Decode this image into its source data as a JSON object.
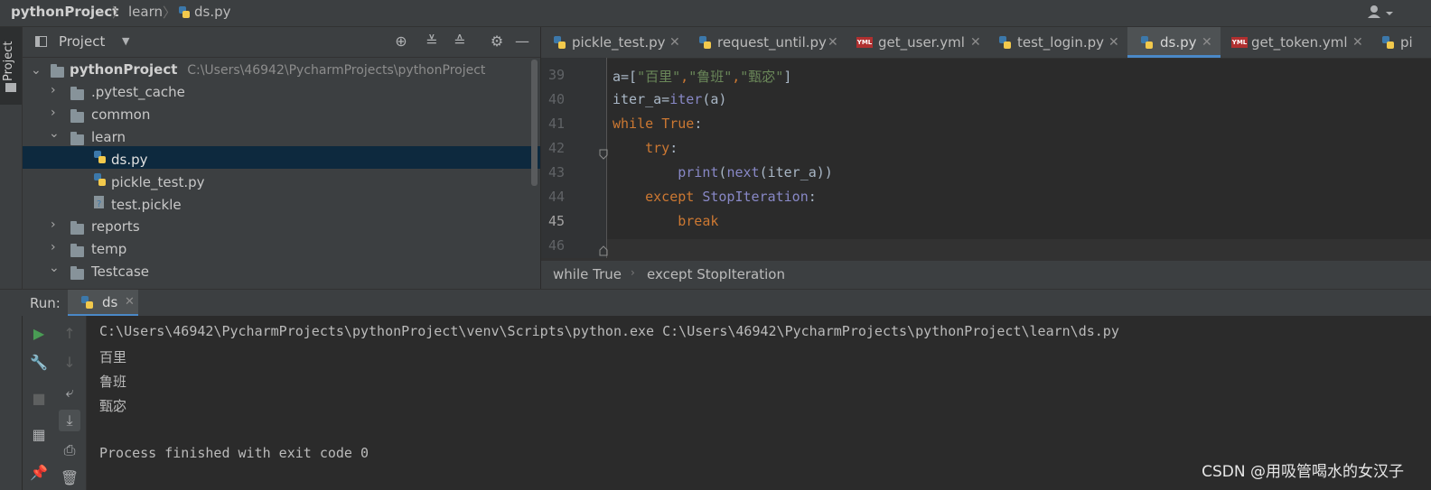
{
  "navbar": {
    "crumbs": [
      "pythonProject",
      "learn",
      "ds.py"
    ],
    "user_icon": "user-icon"
  },
  "left_stripe": {
    "project_label": "Project"
  },
  "project_panel": {
    "title": "Project",
    "tree": [
      {
        "label": "pythonProject",
        "path": "C:\\Users\\46942\\PycharmProjects\\pythonProject",
        "type": "folder",
        "expanded": true
      },
      {
        "label": ".pytest_cache",
        "type": "folder",
        "expanded": false
      },
      {
        "label": "common",
        "type": "folder",
        "expanded": false
      },
      {
        "label": "learn",
        "type": "folder",
        "expanded": true
      },
      {
        "label": "ds.py",
        "type": "python-file",
        "selected": true
      },
      {
        "label": "pickle_test.py",
        "type": "python-file"
      },
      {
        "label": "test.pickle",
        "type": "unknown-file"
      },
      {
        "label": "reports",
        "type": "folder",
        "expanded": false
      },
      {
        "label": "temp",
        "type": "folder",
        "expanded": false
      },
      {
        "label": "Testcase",
        "type": "folder",
        "expanded": true
      }
    ]
  },
  "editor": {
    "tabs": [
      {
        "label": "pickle_test.py",
        "type": "python"
      },
      {
        "label": "request_until.py",
        "type": "python"
      },
      {
        "label": "get_user.yml",
        "type": "yml"
      },
      {
        "label": "test_login.py",
        "type": "python"
      },
      {
        "label": "ds.py",
        "type": "python",
        "active": true
      },
      {
        "label": "get_token.yml",
        "type": "yml"
      },
      {
        "label": "pi",
        "type": "python"
      }
    ],
    "yml_badge": "YML",
    "line_numbers": [
      "39",
      "40",
      "41",
      "42",
      "43",
      "44",
      "45",
      "46"
    ],
    "current_line": "45",
    "code": {
      "l39_a": "a=[",
      "l39_s1": "\"百里\"",
      "l39_c1": ",",
      "l39_s2": "\"鲁班\"",
      "l39_c2": ",",
      "l39_s3": "\"甄宓\"",
      "l39_end": "]",
      "l40_a": "iter_a=",
      "l40_fn": "iter",
      "l40_end": "(a)",
      "l41_kw": "while",
      "l41_kw2": "True",
      "l41_end": ":",
      "l42_kw": "try",
      "l42_end": ":",
      "l43_fn": "print",
      "l43_p": "(",
      "l43_fn2": "next",
      "l43_end": "(iter_a))",
      "l44_kw": "except",
      "l44_cls": "StopIteration",
      "l44_end": ":",
      "l45_kw": "break"
    },
    "breadcrumb": [
      "while True",
      "except StopIteration"
    ]
  },
  "run": {
    "label": "Run:",
    "tab_label": "ds",
    "console": [
      "C:\\Users\\46942\\PycharmProjects\\pythonProject\\venv\\Scripts\\python.exe C:\\Users\\46942\\PycharmProjects\\pythonProject\\learn\\ds.py",
      "百里",
      "鲁班",
      "甄宓",
      "",
      "Process finished with exit code 0"
    ]
  },
  "watermark": "CSDN @用吸管喝水的女汉子",
  "colors": {
    "accent": "#4a88c7",
    "keyword": "#cc7832",
    "string": "#6a8759",
    "builtin": "#8888c6",
    "selection": "#0d293e"
  }
}
